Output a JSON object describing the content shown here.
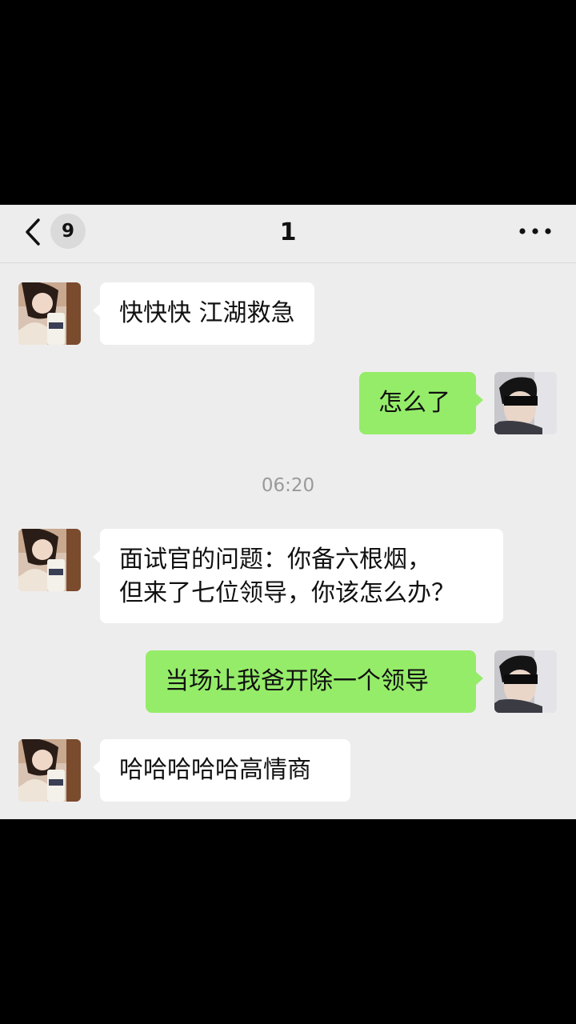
{
  "header": {
    "unread_count": "9",
    "title": "1"
  },
  "messages": [
    {
      "side": "in",
      "text": "快快快 江湖救急"
    },
    {
      "side": "out",
      "text": "怎么了"
    },
    {
      "type": "time",
      "text": "06:20"
    },
    {
      "side": "in",
      "lines": [
        "面试官的问题：你备六根烟，",
        "但来了七位领导，你该怎么办？"
      ]
    },
    {
      "side": "out",
      "text": "当场让我爸开除一个领导"
    },
    {
      "side": "in",
      "text": "哈哈哈哈哈高情商"
    }
  ],
  "colors": {
    "background": "#ededed",
    "incoming_bubble": "#ffffff",
    "outgoing_bubble": "#95ec69"
  }
}
